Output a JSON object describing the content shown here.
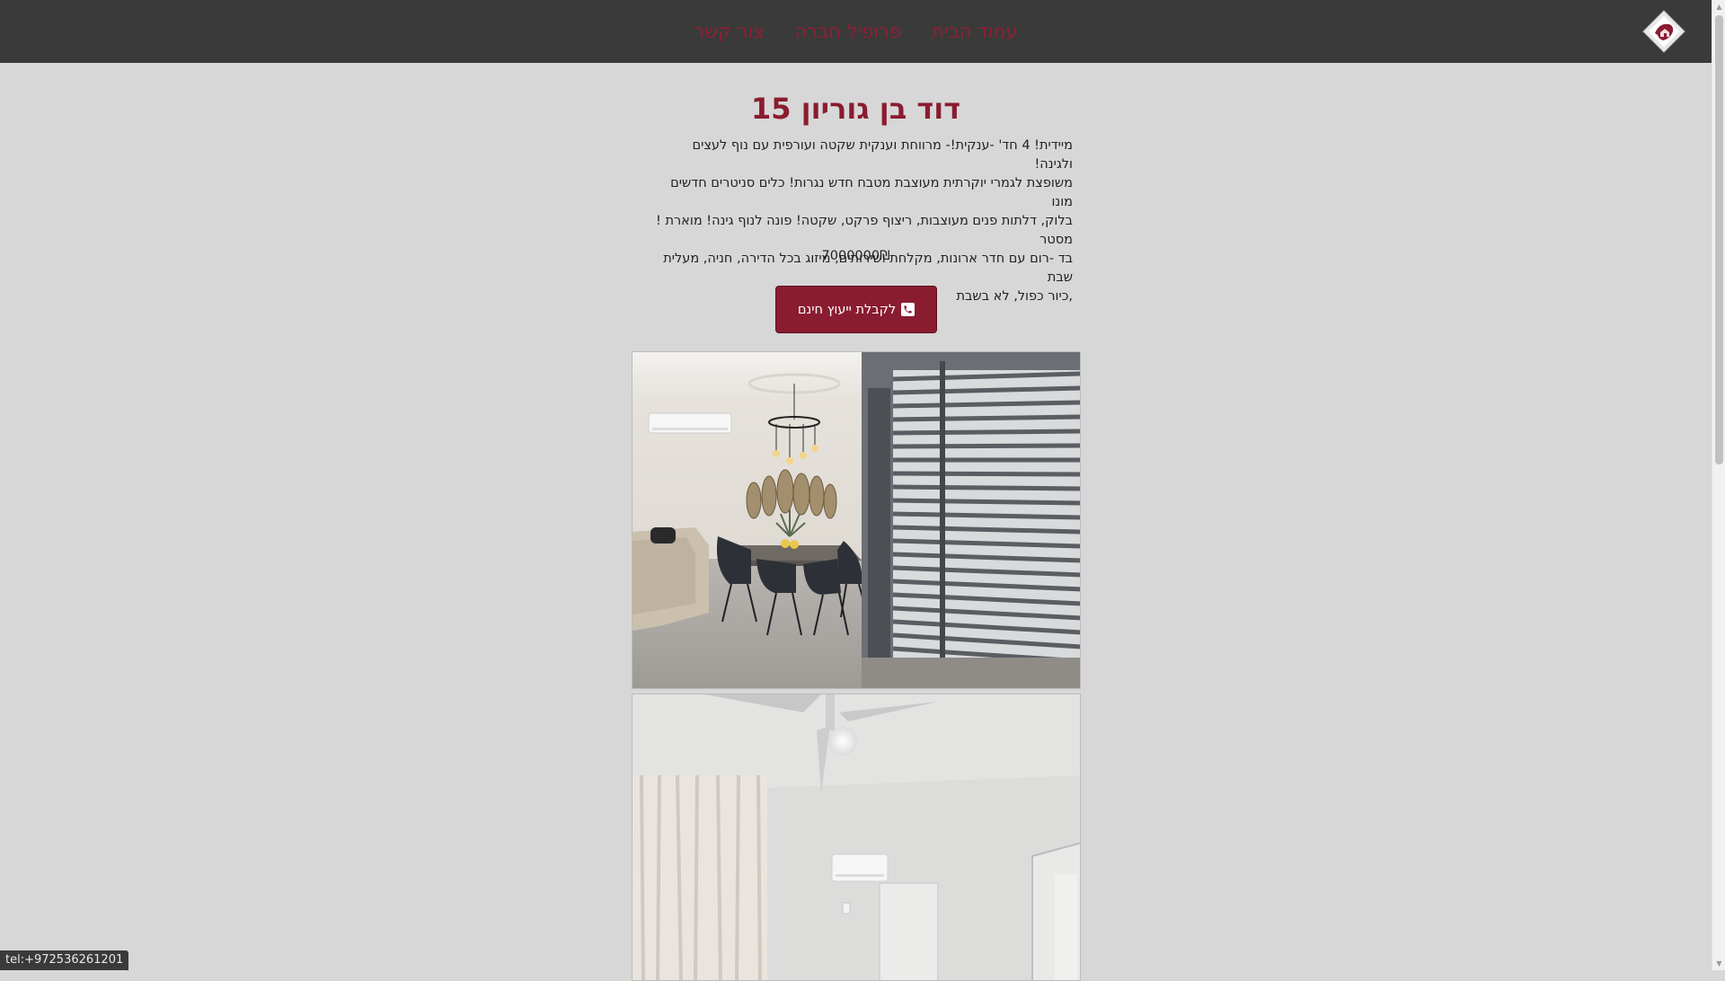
{
  "nav": {
    "items": [
      {
        "label": "עמוד הבית"
      },
      {
        "label": "פרופיל חברה"
      },
      {
        "label": "צור קשר"
      }
    ],
    "logo_icon": "house-diamond-logo-icon"
  },
  "property": {
    "title": "דוד בן גוריון 15",
    "description_lines": [
      "מיידית! 4 חד' -ענקית!- מרווחת וענקית שקטה ועורפית עם נוף לעצים ולגינה!",
      "משופצת לגמרי יוקרתית מעוצבת מטבח חדש נגרות! כלים סניטרים חדשים מונו",
      "בלוק, דלתות פנים מעוצבות, ריצוף פרקט, שקטה! פונה לנוף גינה! מוארת ! מסטר",
      "בד -רום עם חדר ארונות, מקלחת ושירותים, מיזוג בכל הדירה, חניה, מעלית שבת",
      ",כיור כפול, לא בשבת"
    ],
    "price": "7000000₪",
    "cta_label": "לקבלת ייעוץ חינם",
    "cta_icon": "phone-icon"
  },
  "gallery": {
    "photos": [
      {
        "alt": "dining-room-photo"
      },
      {
        "alt": "room-with-ceiling-fan-photo"
      }
    ]
  },
  "status": {
    "link": "tel:+972536261201"
  },
  "colors": {
    "nav_bg": "#3a3a3a",
    "accent": "#8a1c30",
    "page_bg": "#d7d7d7"
  }
}
